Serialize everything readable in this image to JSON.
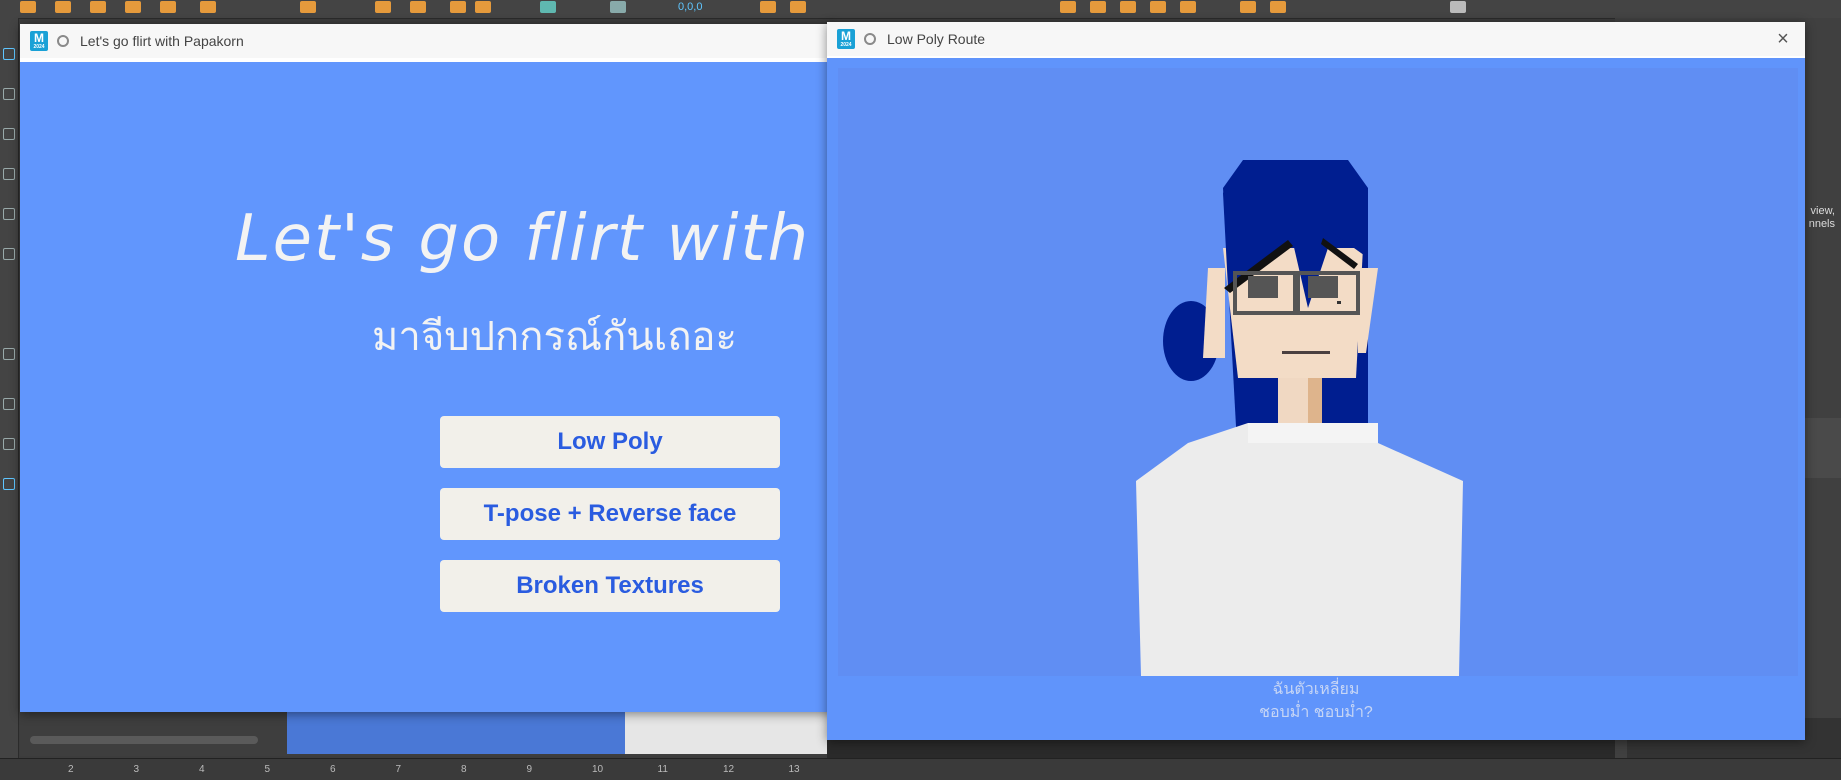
{
  "background": {
    "side_text": "view,\nnnels",
    "timeline_ticks": [
      "2",
      "3",
      "4",
      "5",
      "6",
      "7",
      "8",
      "9",
      "10",
      "11",
      "12",
      "13"
    ],
    "shelf_readout": "0,0,0"
  },
  "menu_window": {
    "title": "Let's go flirt with Papakorn",
    "heading": "Let's go flirt with Papakorn",
    "heading_thai": "มาจีบปกกรณ์กันเถอะ",
    "buttons": [
      {
        "label": "Low Poly"
      },
      {
        "label": "T-pose + Reverse face"
      },
      {
        "label": "Broken Textures"
      }
    ],
    "colors": {
      "background": "#6196fd",
      "button_bg": "#f2f0ea",
      "button_text": "#2a5ce0"
    }
  },
  "route_window": {
    "title": "Low Poly Route",
    "close_icon": "close-icon",
    "dialog_line1": "ฉันตัวเหลี่ยม",
    "dialog_line2": "ชอบม่ำ ชอบม่ำ?",
    "colors": {
      "background": "#6094fb",
      "hair": "#001e90",
      "skin": "#f3dcc6",
      "shirt": "#ececec"
    }
  }
}
